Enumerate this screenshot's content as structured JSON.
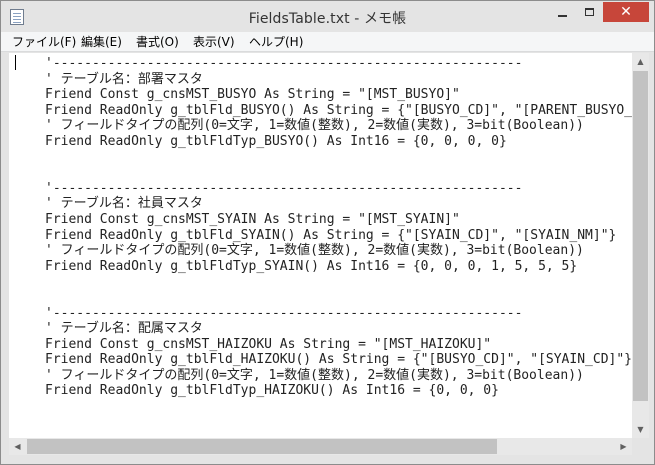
{
  "window": {
    "title": "FieldsTable.txt - メモ帳",
    "close_glyph": "✕"
  },
  "menu": [
    {
      "label": "ファイル(F)"
    },
    {
      "label": "編集(E)"
    },
    {
      "label": "書式(O)"
    },
    {
      "label": "表示(V)"
    },
    {
      "label": "ヘルプ(H)"
    }
  ],
  "editor": {
    "lines": [
      "'------------------------------------------------------------",
      "' テーブル名：部署マスタ",
      "Friend Const g_cnsMST_BUSYO As String = \"[MST_BUSYO]\"",
      "Friend ReadOnly g_tblFld_BUSYO() As String = {\"[BUSYO_CD]\", \"[PARENT_BUSYO_CD]\"}",
      "' フィールドタイプの配列(0=文字, 1=数値(整数), 2=数値(実数), 3=bit(Boolean))",
      "Friend ReadOnly g_tblFldTyp_BUSYO() As Int16 = {0, 0, 0, 0}",
      "",
      "",
      "'------------------------------------------------------------",
      "' テーブル名：社員マスタ",
      "Friend Const g_cnsMST_SYAIN As String = \"[MST_SYAIN]\"",
      "Friend ReadOnly g_tblFld_SYAIN() As String = {\"[SYAIN_CD]\", \"[SYAIN_NM]\"}",
      "' フィールドタイプの配列(0=文字, 1=数値(整数), 2=数値(実数), 3=bit(Boolean))",
      "Friend ReadOnly g_tblFldTyp_SYAIN() As Int16 = {0, 0, 0, 1, 5, 5, 5}",
      "",
      "",
      "'------------------------------------------------------------",
      "' テーブル名：配属マスタ",
      "Friend Const g_cnsMST_HAIZOKU As String = \"[MST_HAIZOKU]\"",
      "Friend ReadOnly g_tblFld_HAIZOKU() As String = {\"[BUSYO_CD]\", \"[SYAIN_CD]\"}",
      "' フィールドタイプの配列(0=文字, 1=数値(整数), 2=数値(実数), 3=bit(Boolean))",
      "Friend ReadOnly g_tblFldTyp_HAIZOKU() As Int16 = {0, 0, 0}"
    ]
  },
  "scrollbars": {
    "up_glyph": "▲",
    "down_glyph": "▼",
    "left_glyph": "◀",
    "right_glyph": "▶"
  },
  "colors": {
    "close_button": "#c7463a",
    "window_frame": "#e4e4e4"
  }
}
